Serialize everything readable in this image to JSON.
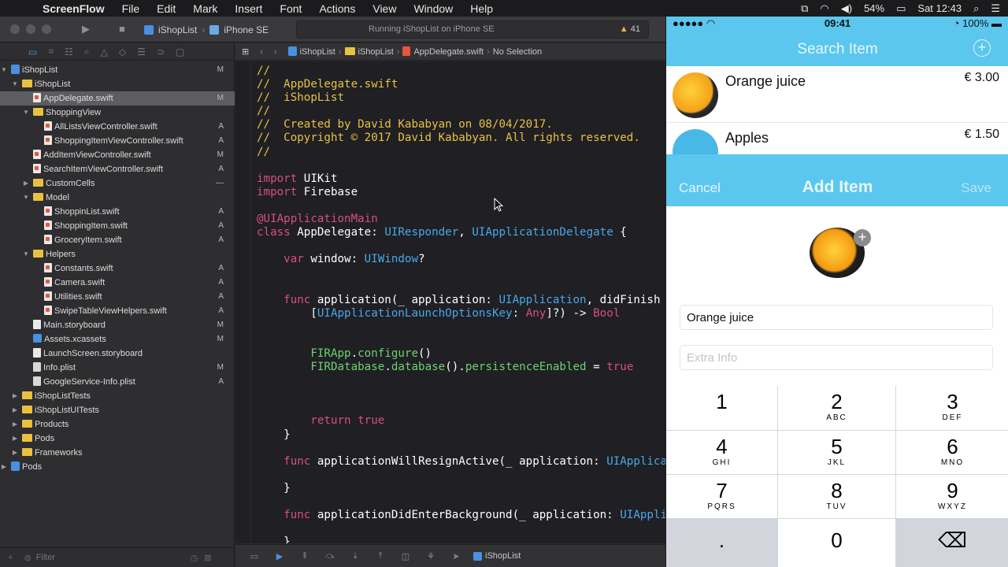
{
  "menubar": {
    "app": "ScreenFlow",
    "items": [
      "File",
      "Edit",
      "Mark",
      "Insert",
      "Font",
      "Actions",
      "View",
      "Window",
      "Help"
    ],
    "battery": "54%",
    "clock": "Sat 12:43"
  },
  "toolbar": {
    "scheme_target": "iShopList",
    "scheme_device": "iPhone SE",
    "status": "Running iShopList on iPhone SE",
    "warnings": "41"
  },
  "navigator": {
    "filter_placeholder": "Filter",
    "tree": [
      {
        "label": "iShopList",
        "badge": "M",
        "depth": 0,
        "kind": "project",
        "open": true
      },
      {
        "label": "iShopList",
        "badge": "",
        "depth": 1,
        "kind": "folder",
        "open": true
      },
      {
        "label": "AppDelegate.swift",
        "badge": "M",
        "depth": 2,
        "kind": "swift",
        "selected": true
      },
      {
        "label": "ShoppingView",
        "badge": "",
        "depth": 2,
        "kind": "folder",
        "open": true
      },
      {
        "label": "AllListsViewController.swift",
        "badge": "A",
        "depth": 3,
        "kind": "swift"
      },
      {
        "label": "ShoppingItemViewController.swift",
        "badge": "A",
        "depth": 3,
        "kind": "swift"
      },
      {
        "label": "AddItemViewController.swift",
        "badge": "M",
        "depth": 2,
        "kind": "swift"
      },
      {
        "label": "SearchItemViewController.swift",
        "badge": "A",
        "depth": 2,
        "kind": "swift"
      },
      {
        "label": "CustomCells",
        "badge": "—",
        "depth": 2,
        "kind": "folder",
        "open": false
      },
      {
        "label": "Model",
        "badge": "",
        "depth": 2,
        "kind": "folder",
        "open": true
      },
      {
        "label": "ShoppinList.swift",
        "badge": "A",
        "depth": 3,
        "kind": "swift"
      },
      {
        "label": "ShoppingItem.swift",
        "badge": "A",
        "depth": 3,
        "kind": "swift"
      },
      {
        "label": "GroceryItem.swift",
        "badge": "A",
        "depth": 3,
        "kind": "swift"
      },
      {
        "label": "Helpers",
        "badge": "",
        "depth": 2,
        "kind": "folder",
        "open": true
      },
      {
        "label": "Constants.swift",
        "badge": "A",
        "depth": 3,
        "kind": "swift"
      },
      {
        "label": "Camera.swift",
        "badge": "A",
        "depth": 3,
        "kind": "swift"
      },
      {
        "label": "Utilities.swift",
        "badge": "A",
        "depth": 3,
        "kind": "swift"
      },
      {
        "label": "SwipeTableViewHelpers.swift",
        "badge": "A",
        "depth": 3,
        "kind": "swift"
      },
      {
        "label": "Main.storyboard",
        "badge": "M",
        "depth": 2,
        "kind": "storyboard"
      },
      {
        "label": "Assets.xcassets",
        "badge": "M",
        "depth": 2,
        "kind": "assets"
      },
      {
        "label": "LaunchScreen.storyboard",
        "badge": "",
        "depth": 2,
        "kind": "storyboard"
      },
      {
        "label": "Info.plist",
        "badge": "M",
        "depth": 2,
        "kind": "plist"
      },
      {
        "label": "GoogleService-Info.plist",
        "badge": "A",
        "depth": 2,
        "kind": "plist"
      },
      {
        "label": "iShopListTests",
        "badge": "",
        "depth": 1,
        "kind": "folder",
        "open": false
      },
      {
        "label": "iShopListUITests",
        "badge": "",
        "depth": 1,
        "kind": "folder",
        "open": false
      },
      {
        "label": "Products",
        "badge": "",
        "depth": 1,
        "kind": "folder",
        "open": false
      },
      {
        "label": "Pods",
        "badge": "",
        "depth": 1,
        "kind": "folder",
        "open": false
      },
      {
        "label": "Frameworks",
        "badge": "",
        "depth": 1,
        "kind": "folder",
        "open": false
      },
      {
        "label": "Pods",
        "badge": "",
        "depth": 0,
        "kind": "project",
        "open": false
      }
    ]
  },
  "jumpbar": {
    "project": "iShopList",
    "group": "iShopList",
    "file": "AppDelegate.swift",
    "selection": "No Selection"
  },
  "editor": {
    "lines": [
      [
        [
          "cm",
          "//"
        ]
      ],
      [
        [
          "cm",
          "//  AppDelegate.swift"
        ]
      ],
      [
        [
          "cm",
          "//  iShopList"
        ]
      ],
      [
        [
          "cm",
          "//"
        ]
      ],
      [
        [
          "cm",
          "//  Created by David Kababyan on 08/04/2017."
        ]
      ],
      [
        [
          "cm",
          "//  Copyright © 2017 David Kababyan. All rights reserved."
        ]
      ],
      [
        [
          "cm",
          "//"
        ]
      ],
      [],
      [
        [
          "kw",
          "import"
        ],
        [
          "",
          " UIKit"
        ]
      ],
      [
        [
          "kw",
          "import"
        ],
        [
          "",
          " Firebase"
        ]
      ],
      [],
      [
        [
          "kw",
          "@UIApplicationMain"
        ]
      ],
      [
        [
          "kw",
          "class"
        ],
        [
          "",
          " AppDelegate: "
        ],
        [
          "ty",
          "UIResponder"
        ],
        [
          "",
          ", "
        ],
        [
          "ty",
          "UIApplicationDelegate"
        ],
        [
          "",
          " {"
        ]
      ],
      [],
      [
        [
          "",
          "    "
        ],
        [
          "kw",
          "var"
        ],
        [
          "",
          " window: "
        ],
        [
          "ty",
          "UIWindow"
        ],
        [
          "",
          "?"
        ]
      ],
      [],
      [],
      [
        [
          "",
          "    "
        ],
        [
          "kw",
          "func"
        ],
        [
          "",
          " application(_ application: "
        ],
        [
          "ty",
          "UIApplication"
        ],
        [
          "",
          ", didFinish"
        ]
      ],
      [
        [
          "",
          "        ["
        ],
        [
          "ty",
          "UIApplicationLaunchOptionsKey"
        ],
        [
          "",
          ": "
        ],
        [
          "kw",
          "Any"
        ],
        [
          "",
          "]?) -> "
        ],
        [
          "kw",
          "Bool"
        ]
      ],
      [],
      [],
      [
        [
          "",
          "        "
        ],
        [
          "fn",
          "FIRApp"
        ],
        [
          "",
          "."
        ],
        [
          "fn",
          "configure"
        ],
        [
          "",
          "()"
        ]
      ],
      [
        [
          "",
          "        "
        ],
        [
          "fn",
          "FIRDatabase"
        ],
        [
          "",
          "."
        ],
        [
          "fn",
          "database"
        ],
        [
          "",
          "()."
        ],
        [
          "fn",
          "persistenceEnabled"
        ],
        [
          "",
          " = "
        ],
        [
          "kw",
          "true"
        ]
      ],
      [],
      [],
      [],
      [
        [
          "",
          "        "
        ],
        [
          "kw",
          "return"
        ],
        [
          "",
          " "
        ],
        [
          "kw",
          "true"
        ]
      ],
      [
        [
          "",
          "    }"
        ]
      ],
      [],
      [
        [
          "",
          "    "
        ],
        [
          "kw",
          "func"
        ],
        [
          "",
          " applicationWillResignActive(_ application: "
        ],
        [
          "ty",
          "UIApplication"
        ],
        [
          "",
          ") {"
        ]
      ],
      [],
      [
        [
          "",
          "    }"
        ]
      ],
      [],
      [
        [
          "",
          "    "
        ],
        [
          "kw",
          "func"
        ],
        [
          "",
          " applicationDidEnterBackground(_ application: "
        ],
        [
          "ty",
          "UIApplication"
        ],
        [
          "",
          ") {"
        ]
      ],
      [],
      [
        [
          "",
          "    }"
        ]
      ]
    ]
  },
  "debugbar": {
    "target": "iShopList"
  },
  "simulator": {
    "carrier": "●●●●●",
    "time": "09:41",
    "battery": "100%",
    "search_title": "Search Item",
    "items": [
      {
        "name": "Orange juice",
        "price": "€ 3.00"
      },
      {
        "name": "Apples",
        "price": "€ 1.50"
      }
    ],
    "cancel": "Cancel",
    "add_title": "Add Item",
    "save": "Save",
    "name_value": "Orange juice",
    "extra_placeholder": "Extra Info",
    "keys": [
      {
        "d": "1",
        "s": ""
      },
      {
        "d": "2",
        "s": "ABC"
      },
      {
        "d": "3",
        "s": "DEF"
      },
      {
        "d": "4",
        "s": "GHI"
      },
      {
        "d": "5",
        "s": "JKL"
      },
      {
        "d": "6",
        "s": "MNO"
      },
      {
        "d": "7",
        "s": "PQRS"
      },
      {
        "d": "8",
        "s": "TUV"
      },
      {
        "d": "9",
        "s": "WXYZ"
      },
      {
        "d": ".",
        "s": ""
      },
      {
        "d": "0",
        "s": ""
      },
      {
        "d": "⌫",
        "s": ""
      }
    ]
  }
}
